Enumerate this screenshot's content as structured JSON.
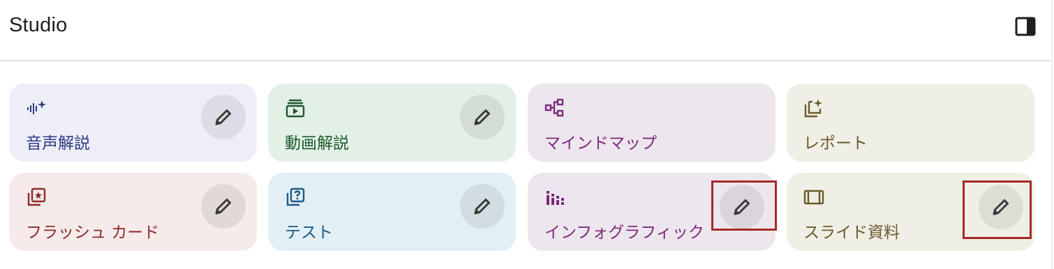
{
  "panel": {
    "title": "Studio",
    "collapse_icon": "side-panel-icon"
  },
  "cards": [
    {
      "label": "音声解説",
      "icon": "audio-sparkle-icon",
      "bg": "#eeeef8",
      "fg": "#2c3a86"
    },
    {
      "label": "動画解説",
      "icon": "video-stack-icon",
      "bg": "#e3f0e6",
      "fg": "#1e5a2e"
    },
    {
      "label": "マインドマップ",
      "icon": "mind-map-icon",
      "bg": "#eee6ee",
      "fg": "#7c2a7c"
    },
    {
      "label": "レポート",
      "icon": "report-sparkle-icon",
      "bg": "#efefe6",
      "fg": "#6b5a2a"
    },
    {
      "label": "フラッシュ カード",
      "icon": "flashcard-star-icon",
      "bg": "#f6eaea",
      "fg": "#8e2a2a"
    },
    {
      "label": "テスト",
      "icon": "quiz-question-icon",
      "bg": "#e2eff4",
      "fg": "#1e5a86"
    },
    {
      "label": "インフォグラフィック",
      "icon": "infographic-bars-icon",
      "bg": "#eee6ee",
      "fg": "#7c2a7c"
    },
    {
      "label": "スライド資料",
      "icon": "slides-icon",
      "bg": "#efefe6",
      "fg": "#6b5a2a"
    }
  ],
  "edit_icon": "pencil-icon",
  "highlight_color": "#a32b24"
}
